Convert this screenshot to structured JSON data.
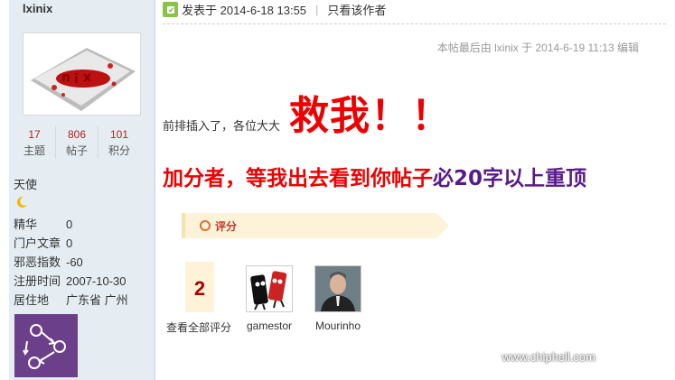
{
  "author": {
    "name": "lxinix",
    "stats": [
      {
        "num": "17",
        "label": "主题"
      },
      {
        "num": "806",
        "label": "帖子"
      },
      {
        "num": "101",
        "label": "积分"
      }
    ],
    "group": "天使",
    "icons": {
      "moon": "moon-icon",
      "medal": "medal-icon"
    },
    "profile": [
      {
        "k": "精华",
        "v": "0"
      },
      {
        "k": "门户文章",
        "v": "0"
      },
      {
        "k": "邪恶指数",
        "v": "-60"
      },
      {
        "k": "注册时间",
        "v": "2007-10-30"
      },
      {
        "k": "居住地",
        "v": "广东省 广州"
      }
    ]
  },
  "post": {
    "posted_at": "发表于 2014-6-18 13:55",
    "only_author": "只看该作者",
    "edit_note": "本帖最后由 lxinix 于 2014-6-19 11:13 编辑",
    "line1_small": "前排插入了，各位大大",
    "line1_big": "救我！！",
    "line2_red": "加分者，等我出去看到你帖子",
    "line2_purple": "必20字以上重顶"
  },
  "rating": {
    "label": "评分",
    "count": "2",
    "view_all": "查看全部评分",
    "raters": [
      {
        "name": "gamestor"
      },
      {
        "name": "Mourinho"
      }
    ]
  },
  "watermark": {
    "url": "www.chiphell.com",
    "logo": "chiphell-logo"
  },
  "colors": {
    "sidebar_bg": "#e5edf2",
    "accent_red": "#ee0000",
    "accent_purple": "#5a1a8a",
    "rate_bar": "#fdf3d8"
  }
}
